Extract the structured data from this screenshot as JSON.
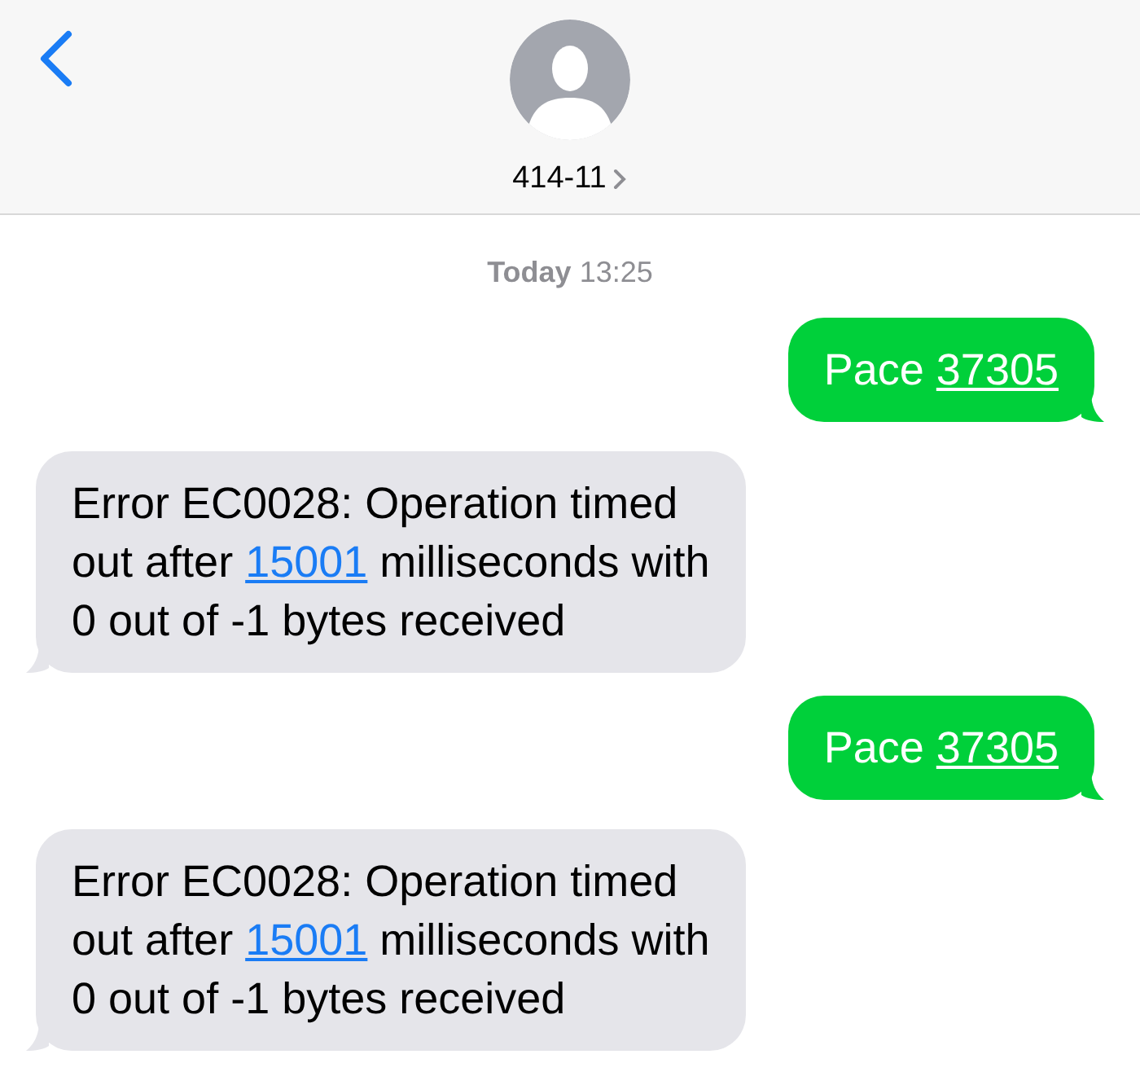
{
  "header": {
    "contact": "414-11"
  },
  "timestamp": "**Today** 13:25",
  "messages": [
    {
      "kind": "outgoing",
      "lines": [
        [
          {
            "kind": "text",
            "text": "Pace "
          },
          {
            "kind": "link",
            "text": "37305"
          }
        ]
      ]
    },
    {
      "kind": "incoming",
      "lines": [
        [
          {
            "kind": "text",
            "text": "Error EC0028: Operation timed"
          }
        ],
        [
          {
            "kind": "text",
            "text": "out after "
          },
          {
            "kind": "link",
            "text": "15001"
          },
          {
            "kind": "text",
            "text": " milliseconds with"
          }
        ],
        [
          {
            "kind": "text",
            "text": "0 out of -1 bytes received"
          }
        ]
      ]
    },
    {
      "kind": "outgoing",
      "lines": [
        [
          {
            "kind": "text",
            "text": "Pace "
          },
          {
            "kind": "link",
            "text": "37305"
          }
        ]
      ]
    },
    {
      "kind": "incoming",
      "lines": [
        [
          {
            "kind": "text",
            "text": "Error EC0028: Operation timed"
          }
        ],
        [
          {
            "kind": "text",
            "text": "out after "
          },
          {
            "kind": "link",
            "text": "15001"
          },
          {
            "kind": "text",
            "text": " milliseconds with"
          }
        ],
        [
          {
            "kind": "text",
            "text": "0 out of -1 bytes received"
          }
        ]
      ]
    }
  ]
}
